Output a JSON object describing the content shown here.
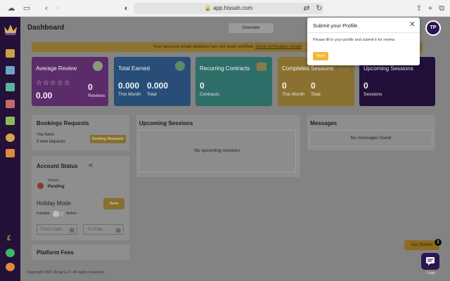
{
  "browser": {
    "url": "app.hissah.com"
  },
  "header": {
    "title": "Dashboard",
    "overview_label": "Overview"
  },
  "alert": {
    "text": "Your account email address has not been verified.",
    "link": "Send verification email"
  },
  "cards": [
    {
      "title": "Average Review",
      "value": "0.00",
      "secondary_value": "0",
      "secondary_label": "Reviews",
      "stars": "☆☆☆☆☆",
      "color": "#5c2c6a"
    },
    {
      "title": "Total Earned",
      "value": "0.000",
      "value_label": "This Month",
      "secondary_value": "0.000",
      "secondary_label": "Total",
      "color": "#284e78"
    },
    {
      "title": "Recurring Contracts",
      "value": "0",
      "value_label": "Contracts",
      "color": "#2e6e69"
    },
    {
      "title": "Completed Sessions",
      "value": "0",
      "value_label": "This Month",
      "secondary_value": "0",
      "secondary_label": "Total",
      "color": "#8a7130"
    },
    {
      "title": "Upcoming Sessions",
      "value": "0",
      "value_label": "Sessions",
      "color": "#22103a"
    }
  ],
  "bookings": {
    "title": "Bookings Requests",
    "line1": "You have",
    "line2": "0 new requests",
    "button": "Booking Requests"
  },
  "account": {
    "title": "Account Status",
    "status_label": "Status",
    "status_value": "Pending",
    "holiday_label": "Holiday Mode",
    "inactive_label": "Inactive",
    "active_label": "Active",
    "save_label": "Save",
    "from_placeholder": "From Date",
    "to_placeholder": "To Date"
  },
  "fees": {
    "title": "Platform Fees"
  },
  "upcoming": {
    "title": "Upcoming Sessions",
    "empty": "No upcoming sessions"
  },
  "messages": {
    "title": "Messages",
    "empty": "No messages found"
  },
  "popover": {
    "title": "Submit your Profile.",
    "body": "Please fill in your profile and submit it for review.",
    "next": "Next",
    "close": "✕"
  },
  "avatar": {
    "initials": "TP"
  },
  "footer": {
    "copyright": "Copyright 2021 Amal LLC. All rights reserved."
  },
  "widget": {
    "get_started": "Get Started",
    "badge": "1",
    "logo_text": "Logo"
  },
  "sidebar": {
    "currency_symbol": "£"
  }
}
